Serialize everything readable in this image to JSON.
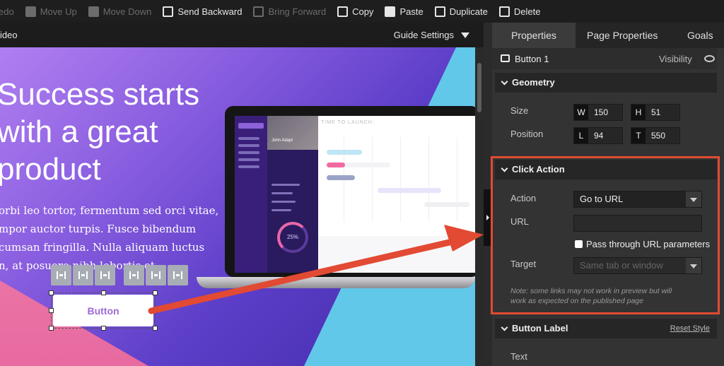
{
  "toolbar": {
    "redo": "edo",
    "move_up": "Move Up",
    "move_down": "Move Down",
    "send_backward": "Send Backward",
    "bring_forward": "Bring Forward",
    "copy": "Copy",
    "paste": "Paste",
    "duplicate": "Duplicate",
    "delete": "Delete"
  },
  "canvas_header": {
    "left_text": "ideo",
    "guide_settings": "Guide Settings"
  },
  "page": {
    "headline": [
      "Success starts",
      "with a great",
      "product"
    ],
    "body": [
      "orbi leo tortor, fermentum sed orci vitae,",
      "mpor auctor turpis. Fusce bibendum",
      "cumsan fringilla. Nulla aliquam luctus",
      "n, at posuere nibh lobortis et."
    ],
    "button_label": "Button"
  },
  "laptop": {
    "time_to_launch": "TIME TO LAUNCH:",
    "gauge_value": "25%",
    "profile_name": "John Adapt"
  },
  "panel": {
    "tabs": [
      "Properties",
      "Page Properties",
      "Goals"
    ],
    "element_name": "Button 1",
    "visibility": "Visibility",
    "geometry": {
      "title": "Geometry",
      "size_label": "Size",
      "position_label": "Position",
      "w_key": "W",
      "w": "150",
      "h_key": "H",
      "h": "51",
      "l_key": "L",
      "l": "94",
      "t_key": "T",
      "t": "550"
    },
    "click_action": {
      "title": "Click Action",
      "action_label": "Action",
      "action_value": "Go to URL",
      "url_label": "URL",
      "url_value": "",
      "pass_through": "Pass through URL parameters",
      "target_label": "Target",
      "target_value": "Same tab or window",
      "note": [
        "Note: some links may not work in preview but will",
        "work as expected on the published page"
      ]
    },
    "button_label_section": {
      "title": "Button Label",
      "reset": "Reset Style",
      "text_label": "Text"
    }
  },
  "colors": {
    "highlight": "#e24a33",
    "button_text": "#a06ad8"
  }
}
